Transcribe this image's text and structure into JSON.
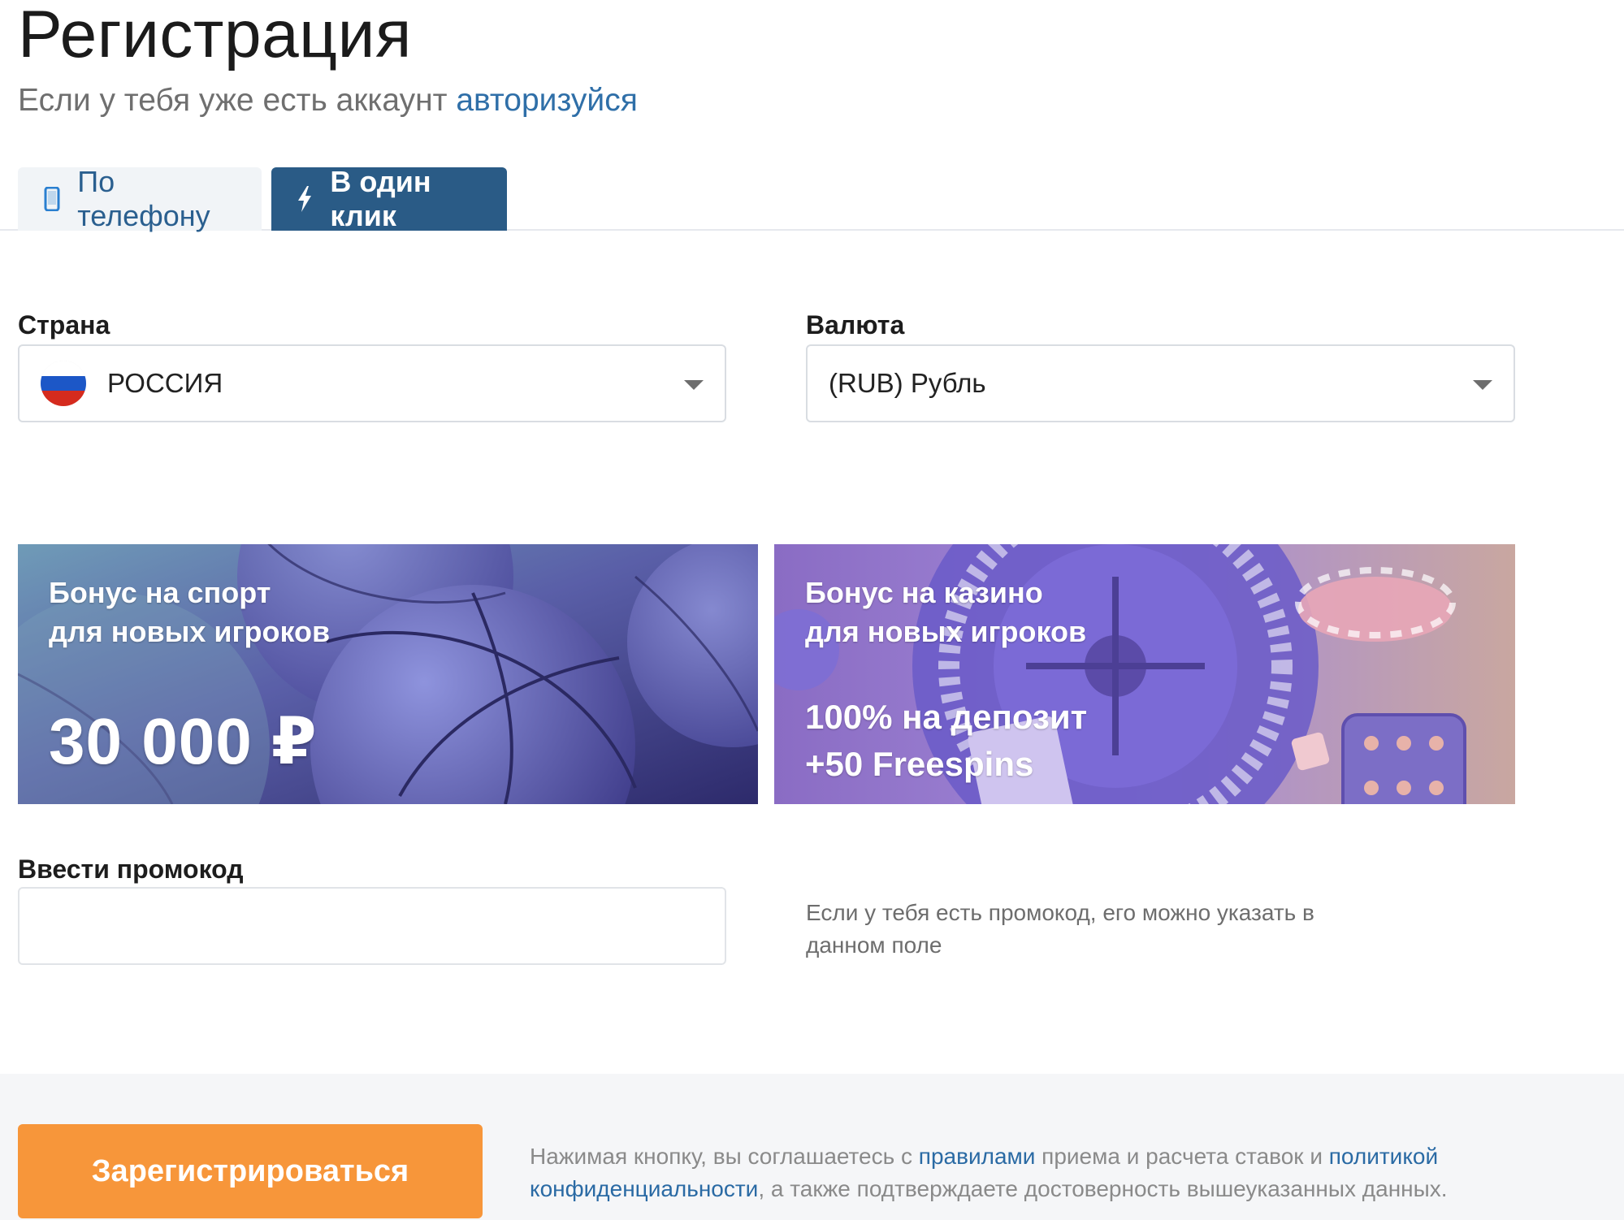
{
  "header": {
    "title": "Регистрация",
    "subtitle_text": "Если у тебя уже есть аккаунт ",
    "subtitle_link": "авторизуйся"
  },
  "tabs": [
    {
      "label": "По телефону",
      "icon": "phone-icon",
      "active": false
    },
    {
      "label": "В один клик",
      "icon": "lightning-icon",
      "active": true
    }
  ],
  "country": {
    "label": "Страна",
    "value": "РОССИЯ",
    "flag_colors": [
      "#ffffff",
      "#1c57c7",
      "#d52b1e"
    ]
  },
  "currency": {
    "label": "Валюта",
    "value": "(RUB) Рубль"
  },
  "banners": {
    "sport": {
      "line1": "Бонус на спорт",
      "line2": "для новых игроков",
      "amount": "30 000 ₽"
    },
    "casino": {
      "line1": "Бонус на казино",
      "line2": "для новых игроков",
      "offer1": "100% на депозит",
      "offer2": "+50 Freespins"
    }
  },
  "promo": {
    "label": "Ввести промокод",
    "value": "",
    "hint": "Если у тебя есть промокод, его можно указать в данном поле"
  },
  "footer": {
    "register_label": "Зарегистрироваться",
    "legal_part1": "Нажимая кнопку, вы соглашаетесь с ",
    "legal_link1": "правилами",
    "legal_part2": " приема и расчета ставок и ",
    "legal_link2": "политикой конфиденциальности",
    "legal_part3": ", а также подтверждаете достоверность вышеуказанных данных."
  },
  "colors": {
    "accent_blue": "#2a5b86",
    "link_blue": "#2f6fa8",
    "register_orange": "#f7963a"
  }
}
